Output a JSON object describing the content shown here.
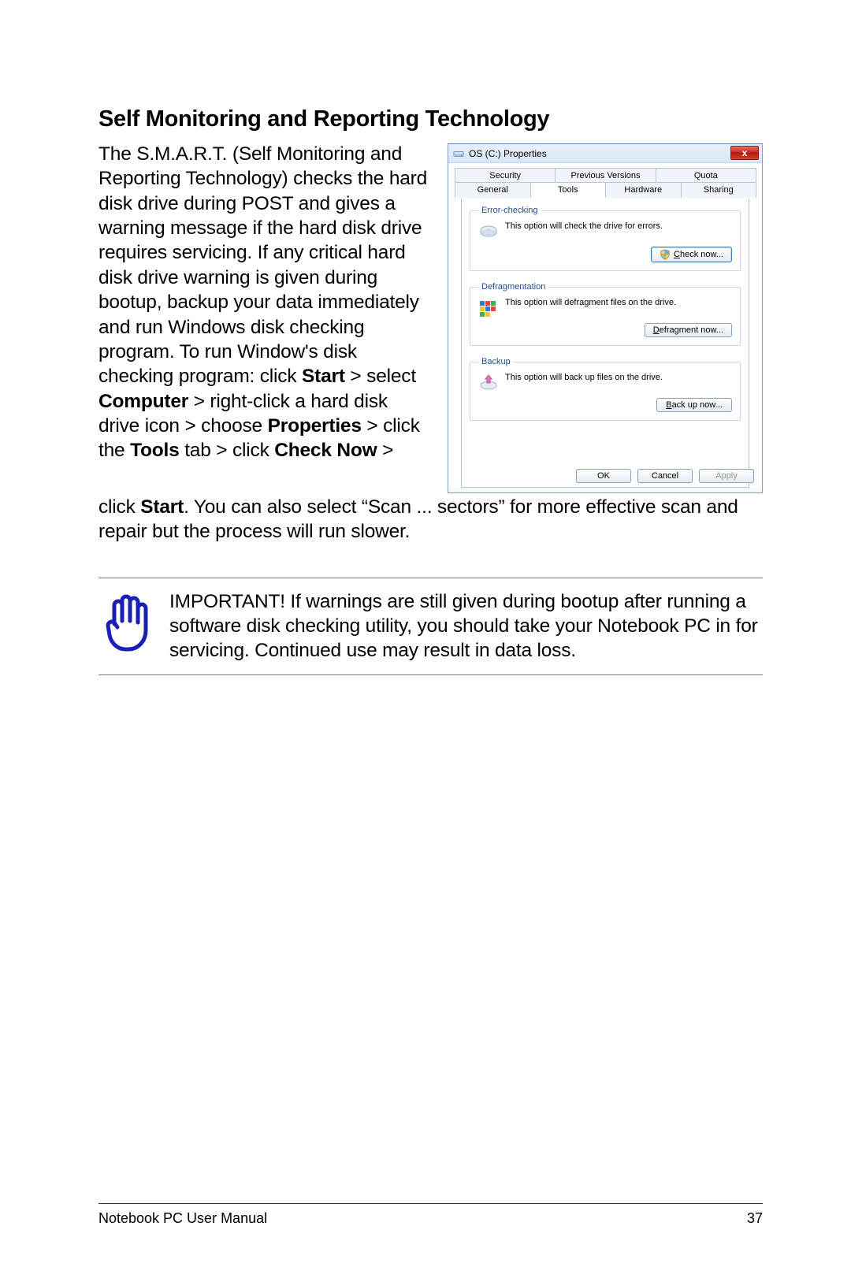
{
  "heading": "Self Monitoring and Reporting Technology",
  "body": {
    "p1a": "The S.M.A.R.T. (Self Monitoring and Reporting Technology) checks the hard disk drive during POST and gives a warning message if the hard disk drive requires servicing. If any critical hard disk drive warning is given during bootup, backup your data immediately and run Windows disk checking program. To run Window's disk checking program: click ",
    "b1": "Start",
    "p1b": " > select ",
    "b2": "Computer",
    "p1c": " > right-click a hard disk drive icon > choose ",
    "b3": "Properties",
    "p1d": " > click the ",
    "b4": "Tools",
    "p1e": " tab > click ",
    "b5": "Check Now",
    "p1f": " > ",
    "p2a": "click ",
    "b6": "Start",
    "p2b": ". You can also select “Scan ... sectors” for more effective scan and repair but the process will run slower."
  },
  "dialog": {
    "title": "OS (C:) Properties",
    "close": "x",
    "tabs_row1": [
      "Security",
      "Previous Versions",
      "Quota"
    ],
    "tabs_row2": [
      "General",
      "Tools",
      "Hardware",
      "Sharing"
    ],
    "active_tab": "Tools",
    "groups": {
      "error": {
        "legend": "Error-checking",
        "text": "This option will check the drive for errors.",
        "button_prefix": "C",
        "button_rest": "heck now..."
      },
      "defrag": {
        "legend": "Defragmentation",
        "text": "This option will defragment files on the drive.",
        "button_prefix": "D",
        "button_rest": "efragment now..."
      },
      "backup": {
        "legend": "Backup",
        "text": "This option will back up files on the drive.",
        "button_prefix": "B",
        "button_rest": "ack up now..."
      }
    },
    "footer": {
      "ok": "OK",
      "cancel": "Cancel",
      "apply": "Apply"
    }
  },
  "note": {
    "text": "IMPORTANT! If warnings are still given during bootup after running a software disk checking utility, you should take your Notebook PC in for servicing. Continued use may result in data loss."
  },
  "footer": {
    "left": "Notebook PC User Manual",
    "right": "37"
  }
}
